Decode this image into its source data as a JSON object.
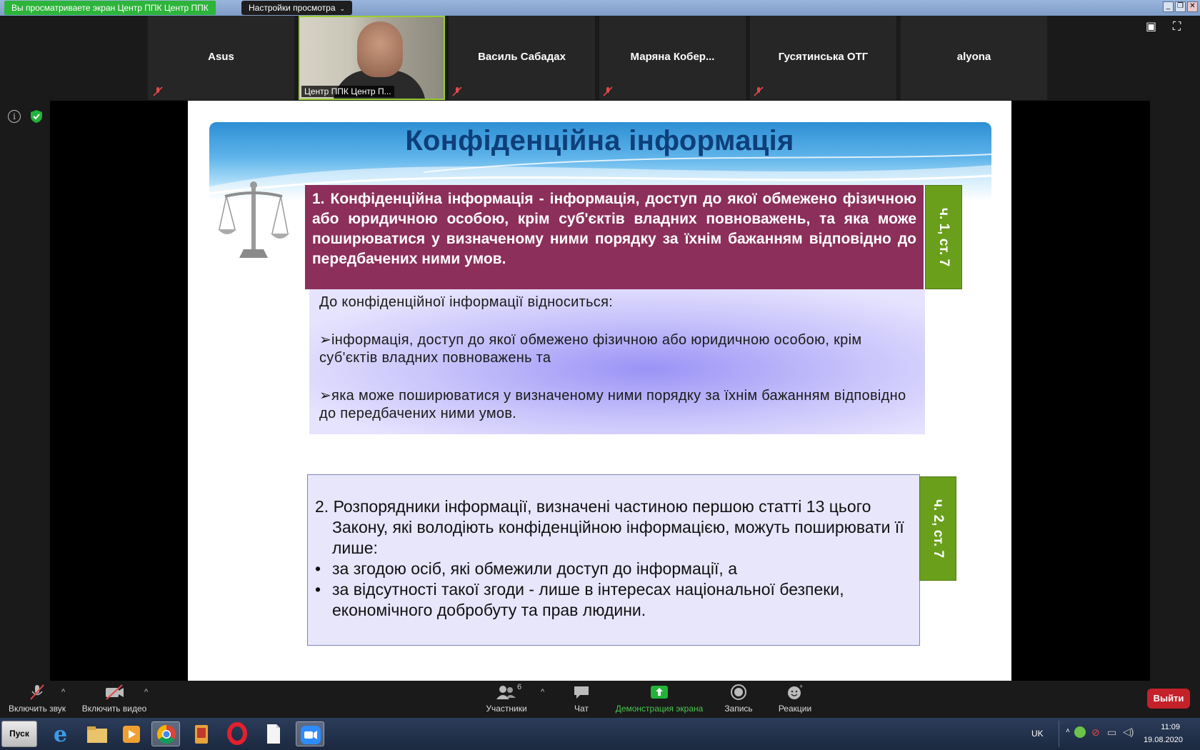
{
  "top_bar": {
    "share_notice": "Вы просматриваете экран Центр ППК Центр ППК",
    "view_options": "Настройки просмотра"
  },
  "participants": [
    {
      "name": "Asus"
    },
    {
      "name": "Центр ППК Центр П..."
    },
    {
      "name": "Василь Сабадах"
    },
    {
      "name": "Маряна  Кобер..."
    },
    {
      "name": "Гусятинська ОТГ"
    },
    {
      "name": "alyona"
    }
  ],
  "slide": {
    "title": "Конфіденційна інформація",
    "box1": "1. Конфіденційна інформація - інформація, доступ до якої обмежено фізичною або юридичною особою, крім суб'єктів владних повноважень, та яка може поширюватися у визначеному ними порядку за їхнім бажанням відповідно до передбачених ними умов.",
    "tag1": "ч. 1, ст. 7",
    "box1_sub": {
      "intro": "До конфіденційної інформації відноситься:",
      "item1": "➢інформація, доступ до якої обмежено фізичною або юридичною особою, крім суб'єктів владних повноважень та",
      "item2": "➢яка може поширюватися у визначеному ними порядку за їхнім бажанням відповідно до передбачених ними умов."
    },
    "box2": {
      "para": "2. Розпорядники інформації, визначені частиною першою статті 13 цього Закону, які володіють конфіденційною інформацією, можуть поширювати її лише:",
      "bullet1": "за згодою осіб, які обмежили доступ до інформації, а",
      "bullet2": "за відсутності такої згоди - лише в інтересах національної безпеки, економічного добробуту та прав людини."
    },
    "tag2": "ч. 2, ст. 7"
  },
  "toolbar": {
    "unmute": "Включить звук",
    "start_video": "Включить видео",
    "participants": "Участники",
    "participants_count": "6",
    "chat": "Чат",
    "share_screen": "Демонстрация экрана",
    "record": "Запись",
    "reactions": "Реакции",
    "leave": "Выйти"
  },
  "taskbar": {
    "start": "Пуск",
    "lang": "UK",
    "time": "11:09",
    "date": "19.08.2020"
  },
  "colors": {
    "accent_green": "#2db43a",
    "slide_title": "#0d3f7a",
    "box1_bg": "#8c2f5a",
    "tag_green": "#6a9f1b",
    "leave_red": "#c4212b"
  }
}
